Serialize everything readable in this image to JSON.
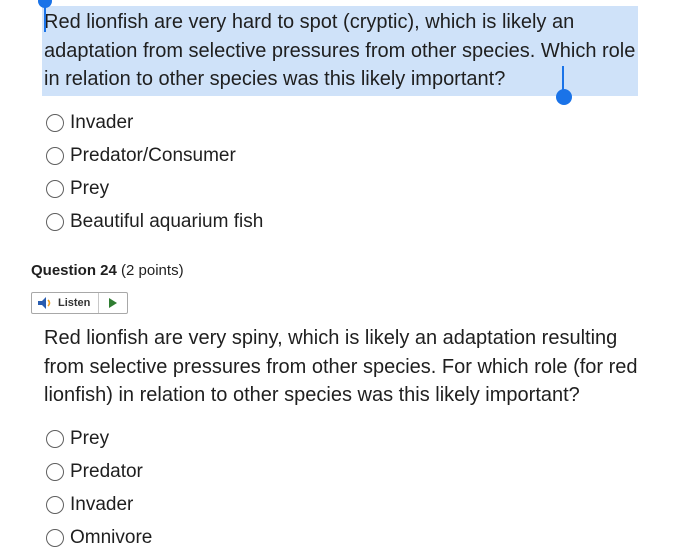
{
  "question1": {
    "text": "Red lionfish are very hard to spot (cryptic), which is likely an adaptation from selective pressures from other species. Which role in relation to other species was this likely important?",
    "options": [
      "Invader",
      "Predator/Consumer",
      "Prey",
      "Beautiful aquarium fish"
    ]
  },
  "question2": {
    "label": "Question 24",
    "points": "(2 points)",
    "listen_label": "Listen",
    "text": "Red lionfish are very spiny, which is likely an adaptation resulting from selective pressures from other species. For which role (for red lionfish) in relation to other species was this likely important?",
    "options": [
      "Prey",
      "Predator",
      "Invader",
      "Omnivore"
    ]
  },
  "colors": {
    "selection_highlight": "#cfe2f9",
    "selection_handle": "#1a73e8",
    "play_icon": "#2f7d32"
  },
  "icons": {
    "speaker": "speaker-icon",
    "play": "play-icon"
  }
}
